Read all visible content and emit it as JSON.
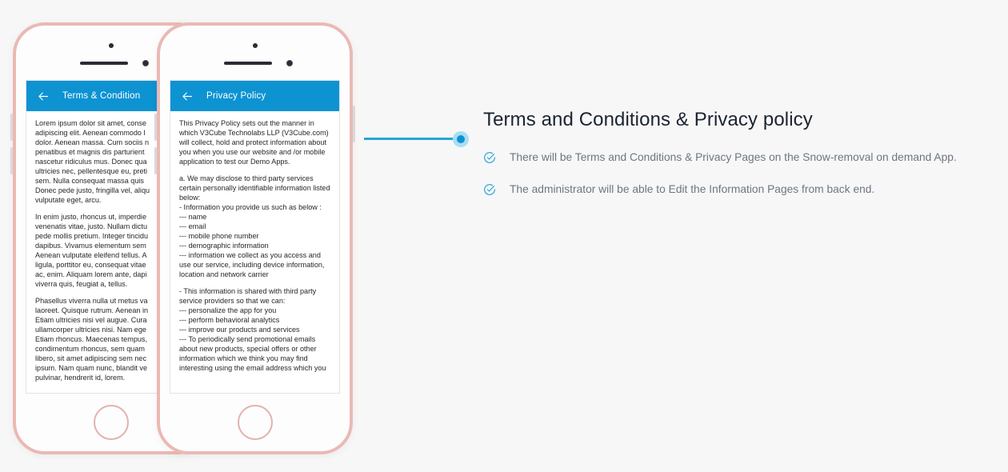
{
  "phones": [
    {
      "id": "terms",
      "app_bar": {
        "back_icon": "back-arrow-icon",
        "title": "Terms & Condition"
      },
      "paragraphs": [
        "Lorem ipsum dolor sit amet, conse\nadipiscing elit. Aenean commodo l\ndolor. Aenean massa. Cum sociis n\npenatibus et magnis dis parturient\nnascetur ridiculus mus. Donec qua\nultricies nec, pellentesque eu, preti\nsem. Nulla consequat massa quis\nDonec pede justo, fringilla vel, aliqu\nvulputate eget, arcu.",
        "In enim justo, rhoncus ut, imperdie\nvenenatis vitae, justo. Nullam dictu\npede mollis pretium. Integer tincidu\ndapibus. Vivamus elementum sem\nAenean vulputate eleifend tellus. A\nligula, porttitor eu, consequat vitae\nac, enim. Aliquam lorem ante, dapi\nviverra quis, feugiat a, tellus.",
        "Phasellus viverra nulla ut metus va\nlaoreet. Quisque rutrum. Aenean in\nEtiam ultricies nisi vel augue. Cura\nullamcorper ultricies nisi. Nam ege\nEtiam rhoncus. Maecenas tempus,\ncondimentum rhoncus, sem quam\nlibero, sit amet adipiscing sem nec\nipsum. Nam quam nunc, blandit ve\npulvinar, hendrerit id, lorem."
      ]
    },
    {
      "id": "privacy",
      "app_bar": {
        "back_icon": "back-arrow-icon",
        "title": "Privacy Policy"
      },
      "paragraphs": [
        "This Privacy Policy sets out the manner in which V3Cube Technolabs LLP (V3Cube.com) will collect, hold and protect information about you when you use our website and /or mobile application to test our Demo Apps.",
        "a. We may disclose to third party services certain personally identifiable information listed below:\n- Information you provide us such as below :\n--- name\n--- email\n--- mobile phone number\n--- demographic information\n--- information we collect as you access and use our service, including device information, location and network carrier",
        "- This information is shared with third party service providers so that we can:\n--- personalize the app for you\n--- perform behavioral analytics\n--- improve our products and services\n--- To periodically send promotional emails about new products, special offers or other information which we think you may find interesting using the email address which you"
      ]
    }
  ],
  "content": {
    "title": "Terms and Conditions & Privacy policy",
    "bullets": [
      {
        "icon": "check-circle-icon",
        "text": "There will be Terms and Conditions & Privacy Pages on the Snow-removal on demand App."
      },
      {
        "icon": "check-circle-icon",
        "text": "The administrator will be able to Edit the Information Pages from back end."
      }
    ]
  },
  "colors": {
    "app_bar": "#0d93d2",
    "accent": "#26a6d8",
    "frame": "#eab9b4",
    "title": "#1b2430",
    "body_text": "#6e7681",
    "background": "#f7f7f7"
  }
}
